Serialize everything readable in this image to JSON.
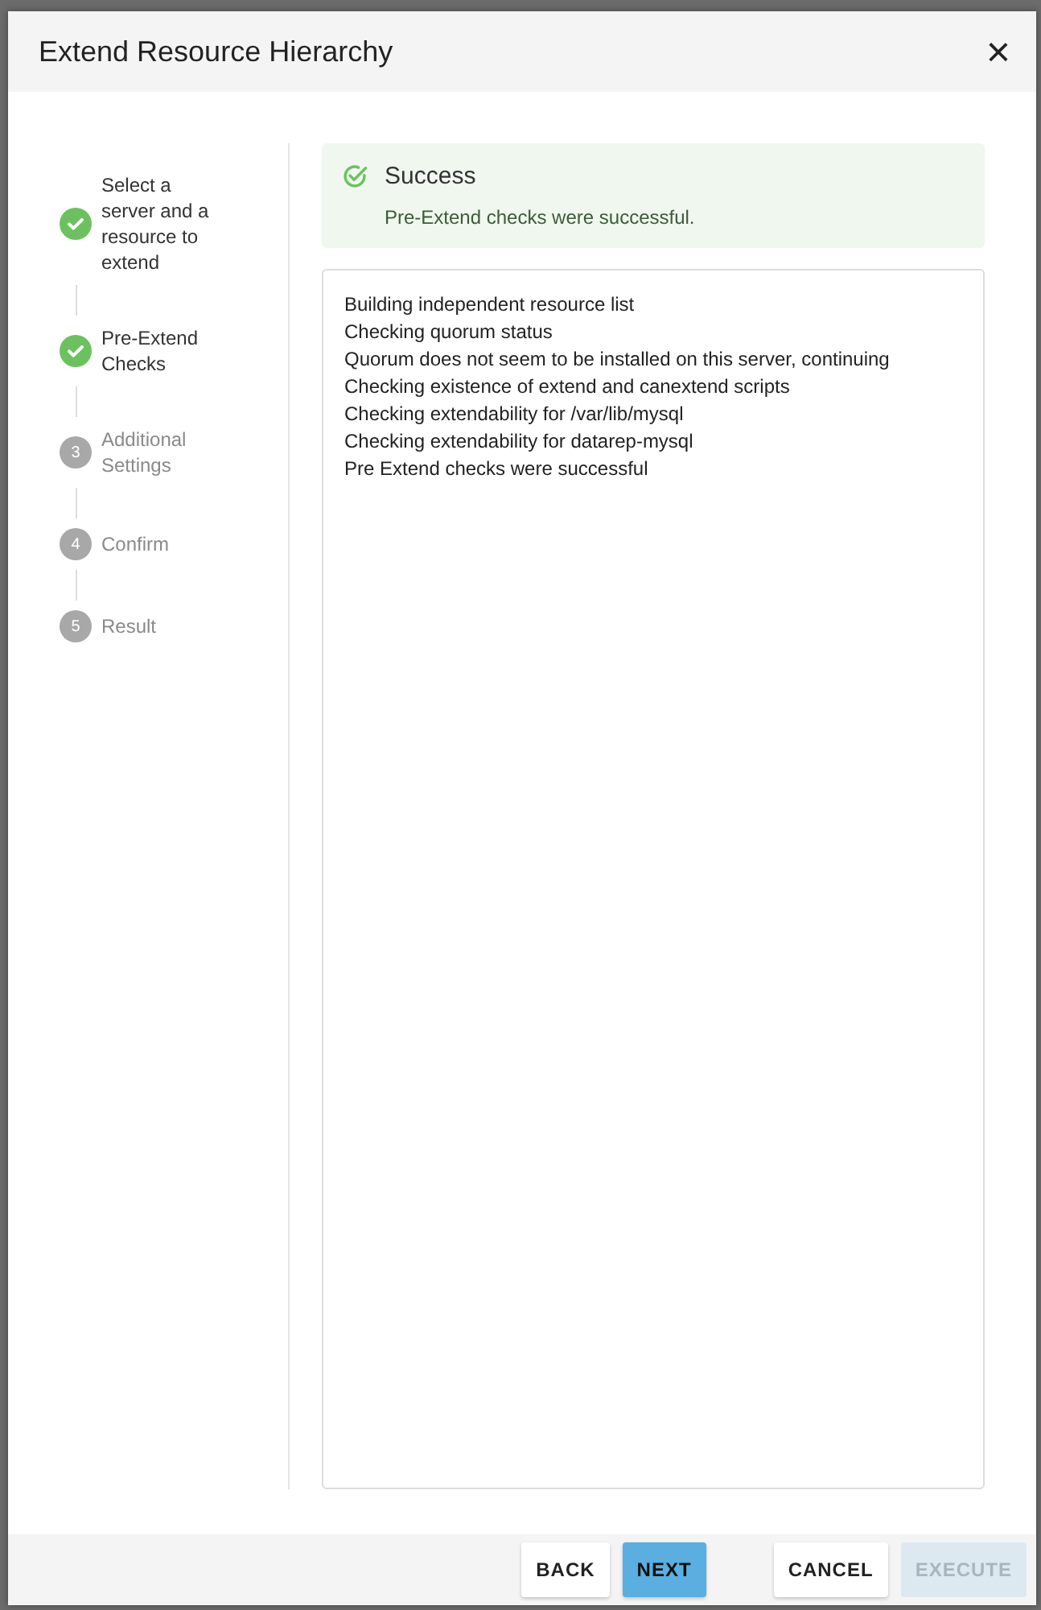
{
  "dialog": {
    "title": "Extend Resource Hierarchy",
    "close": "×"
  },
  "steps": [
    {
      "label": "Select a server and a resource to extend",
      "done": true
    },
    {
      "label": "Pre-Extend Checks",
      "done": true
    },
    {
      "label": "Additional Settings",
      "number": "3",
      "done": false
    },
    {
      "label": "Confirm",
      "number": "4",
      "done": false
    },
    {
      "label": "Result",
      "number": "5",
      "done": false
    }
  ],
  "alert": {
    "title": "Success",
    "message": "Pre-Extend checks were successful."
  },
  "log": [
    "Building independent resource list",
    "Checking quorum status",
    "Quorum does not seem to be installed on this server, continuing",
    "Checking existence of extend and canextend scripts",
    "Checking extendability for /var/lib/mysql",
    "Checking extendability for datarep-mysql",
    "Pre Extend checks were successful"
  ],
  "buttons": [
    {
      "label": "BACK",
      "kind": "default",
      "disabled": false
    },
    {
      "label": "NEXT",
      "kind": "primary",
      "disabled": false
    },
    {
      "label": "CANCEL",
      "kind": "default",
      "disabled": false
    },
    {
      "label": "EXECUTE",
      "kind": "default",
      "disabled": true
    }
  ]
}
